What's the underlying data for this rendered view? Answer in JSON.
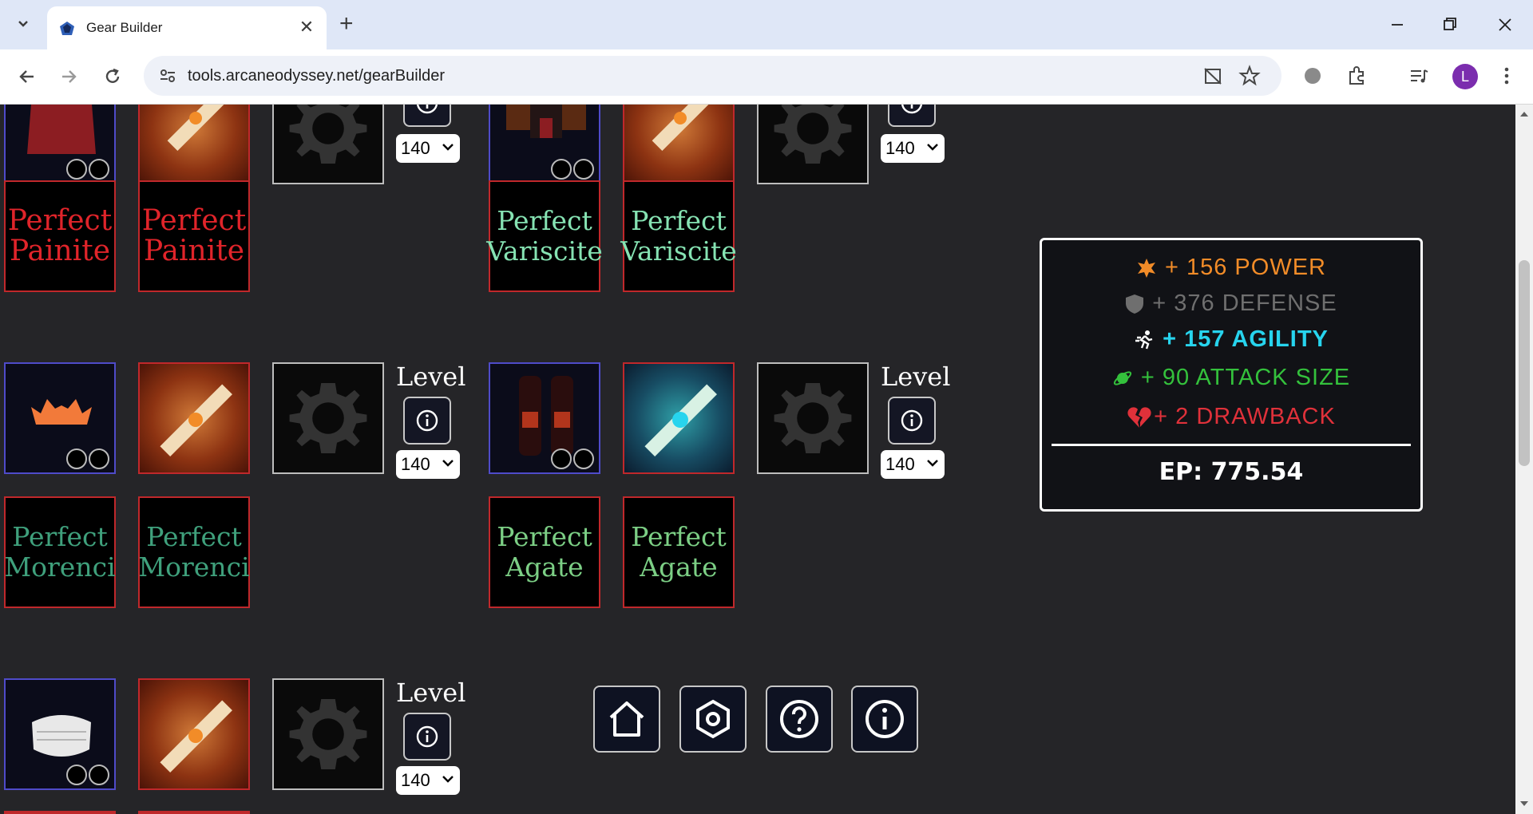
{
  "browser": {
    "tab_title": "Gear Builder",
    "url": "tools.arcaneodyssey.net/gearBuilder",
    "profile_initial": "L"
  },
  "gems": {
    "row1": [
      "Perfect\nPainite",
      "Perfect\nPainite",
      "Perfect\nVariscite",
      "Perfect\nVariscite"
    ],
    "row2": [
      "Perfect\nMorenci",
      "Perfect\nMorenci",
      "Perfect\nAgate",
      "Perfect\nAgate"
    ]
  },
  "level": {
    "label": "Level",
    "value": "140"
  },
  "stats": {
    "power": "+ 156 POWER",
    "defense": "+ 376 DEFENSE",
    "agility": "+ 157 AGILITY",
    "attack_size": "+ 90 ATTACK SIZE",
    "drawback": "+ 2 DRAWBACK",
    "ep": "EP: 775.54"
  },
  "colors": {
    "painite": "#e0242a",
    "variscite": "#86e3b3",
    "morenci": "#3fa07c",
    "agate": "#7ccf85",
    "power": "#f28c28",
    "defense": "#6f6f6f",
    "agility": "#27d4ee",
    "attack_size": "#34c13c",
    "drawback": "#e0313a"
  }
}
